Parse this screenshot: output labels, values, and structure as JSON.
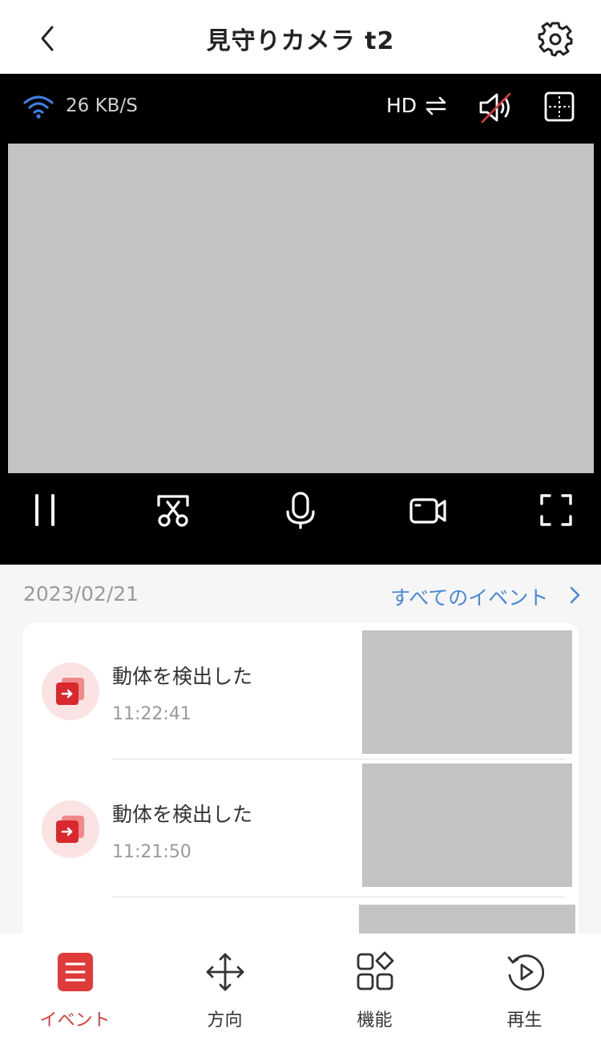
{
  "header": {
    "title": "見守りカメラ t2"
  },
  "player": {
    "speed": "26 KB/S",
    "quality": "HD"
  },
  "events": {
    "date": "2023/02/21",
    "all_events_label": "すべてのイベント",
    "items": [
      {
        "title": "動体を検出した",
        "time": "11:22:41"
      },
      {
        "title": "動体を検出した",
        "time": "11:21:50"
      }
    ]
  },
  "nav": {
    "items": [
      {
        "label": "イベント",
        "icon": "event-icon",
        "active": true
      },
      {
        "label": "方向",
        "icon": "direction-icon",
        "active": false
      },
      {
        "label": "機能",
        "icon": "features-icon",
        "active": false
      },
      {
        "label": "再生",
        "icon": "playback-icon",
        "active": false
      }
    ]
  },
  "colors": {
    "accent": "#e03b3b",
    "link": "#4a88d8",
    "wifi": "#3d7fe0"
  }
}
